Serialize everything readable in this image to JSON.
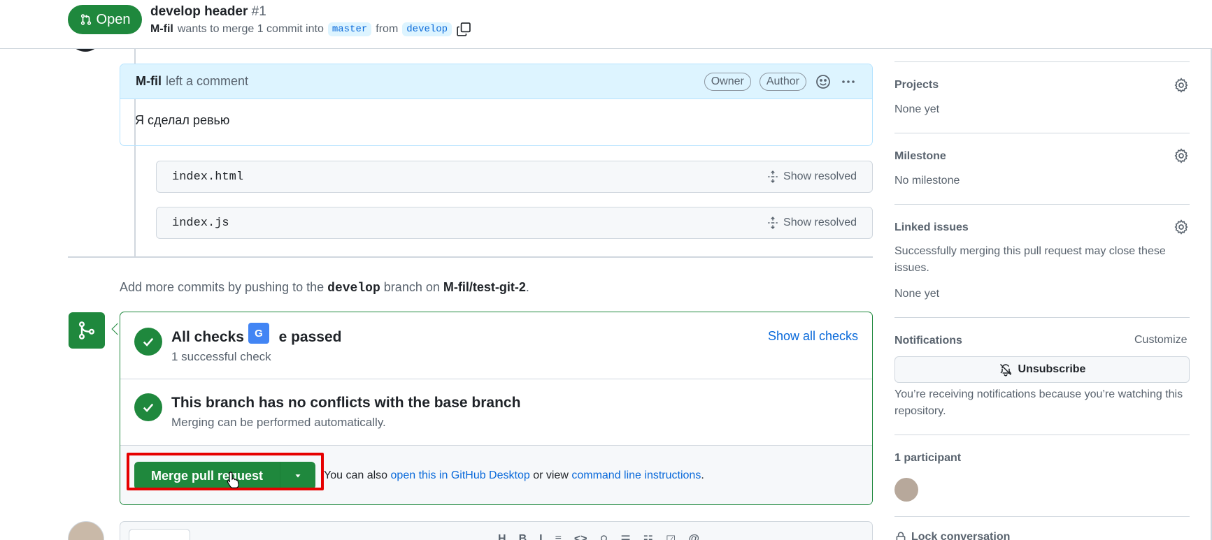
{
  "header": {
    "state_label": "Open",
    "title": "develop header",
    "number": "#1",
    "author": "M-fil",
    "merge_text_1": "wants to merge 1 commit into",
    "base_branch": "master",
    "merge_text_2": "from",
    "head_branch": "develop"
  },
  "comment": {
    "author": "M-fil",
    "action": "left a comment",
    "badges": [
      "Owner",
      "Author"
    ],
    "body": "Я сделал ревью"
  },
  "review_threads": [
    {
      "file": "index.html",
      "action": "Show resolved"
    },
    {
      "file": "index.js",
      "action": "Show resolved"
    }
  ],
  "add_commits": {
    "prefix": "Add more commits by pushing to the",
    "branch": "develop",
    "middle": "branch on",
    "repo": "M-fil/test-git-2",
    "suffix": "."
  },
  "merge_box": {
    "checks_title_start": "All checks",
    "checks_title_end": "e passed",
    "checks_sub": "1 successful check",
    "show_all_checks": "Show all checks",
    "conflicts_title": "This branch has no conflicts with the base branch",
    "conflicts_sub": "Merging can be performed automatically.",
    "merge_button": "Merge pull request",
    "also_text": "You can also",
    "desktop_link": "open this in GitHub Desktop",
    "or_view": "or view",
    "cli_link": "command line instructions",
    "end": ".",
    "translate_glyph": "G"
  },
  "sidebar": {
    "projects": {
      "heading": "Projects",
      "value": "None yet"
    },
    "milestone": {
      "heading": "Milestone",
      "value": "No milestone"
    },
    "linked_issues": {
      "heading": "Linked issues",
      "description": "Successfully merging this pull request may close these issues.",
      "value": "None yet"
    },
    "notifications": {
      "heading": "Notifications",
      "customize": "Customize",
      "button": "Unsubscribe",
      "description": "You’re receiving notifications because you’re watching this repository."
    },
    "participants": {
      "heading": "1 participant"
    },
    "lock": "Lock conversation"
  },
  "colors": {
    "success": "#1f883d",
    "accent": "#0969da",
    "highlight": "#e60000",
    "comment_header": "#ddf4ff"
  }
}
